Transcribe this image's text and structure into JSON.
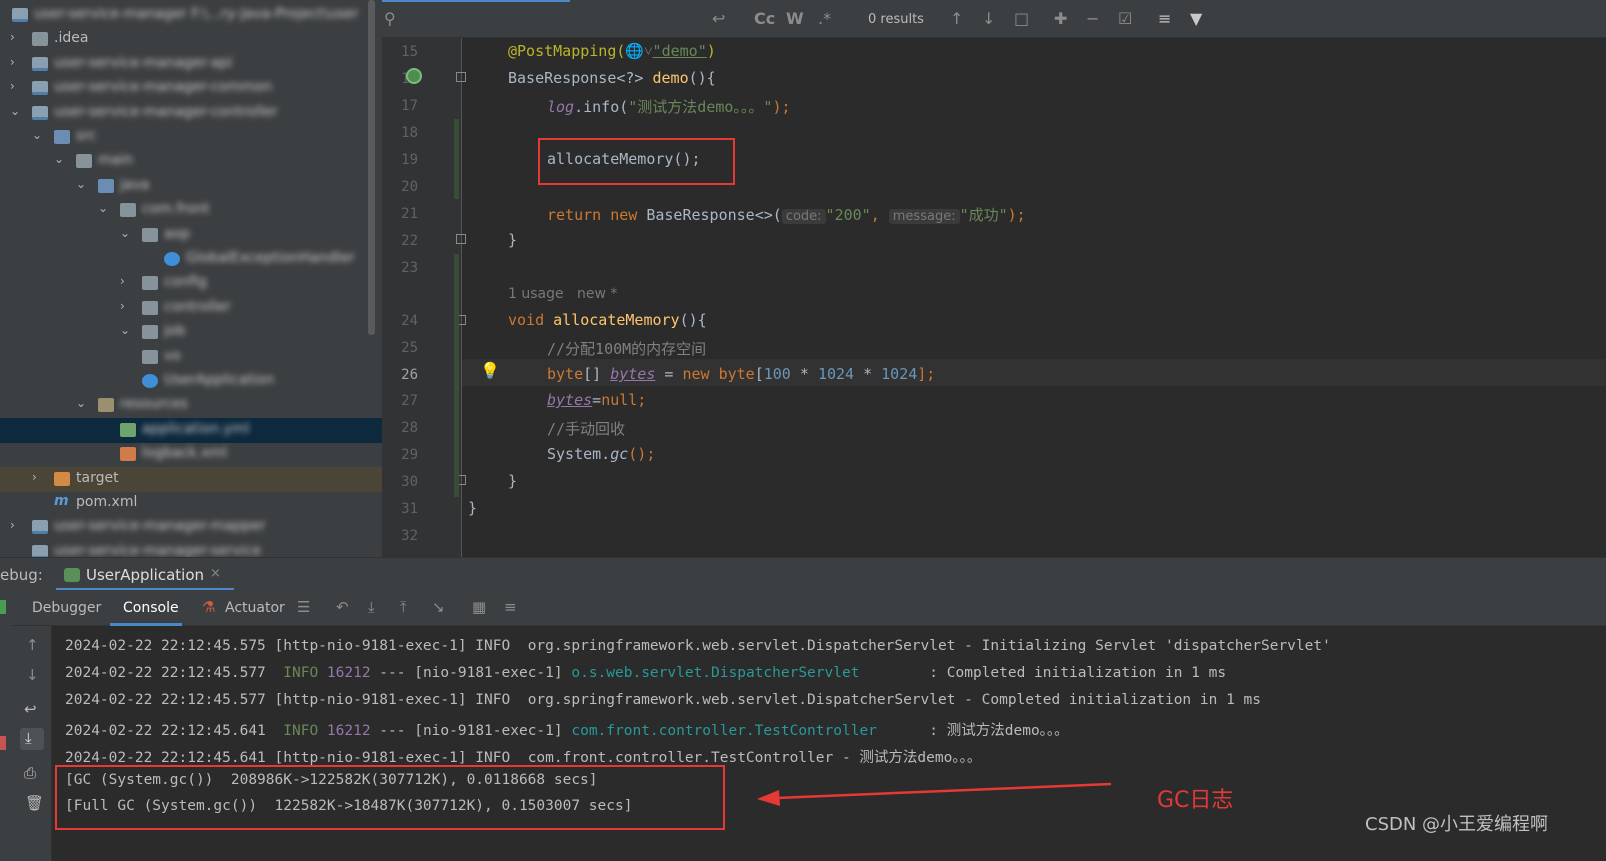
{
  "project_tree": {
    "rows": [
      {
        "label": "user-service-manager",
        "suffix": "F:\\...ry-Java-Project\\user",
        "blurred": true
      },
      {
        "label": ".idea",
        "blurred": false
      },
      {
        "label": "user-service-manager-api",
        "blurred": true
      },
      {
        "label": "user-service-manager-common",
        "blurred": true
      },
      {
        "label": "user-service-manager-controller",
        "blurred": true
      },
      {
        "label": "src",
        "blurred": true
      },
      {
        "label": "main",
        "blurred": true
      },
      {
        "label": "java",
        "blurred": true
      },
      {
        "label": "com.front",
        "blurred": true
      },
      {
        "label": "aop",
        "blurred": true
      },
      {
        "label": "GlobalExceptionHandler",
        "blurred": true
      },
      {
        "label": "config",
        "blurred": true
      },
      {
        "label": "controller",
        "blurred": true
      },
      {
        "label": "job",
        "blurred": true
      },
      {
        "label": "vo",
        "blurred": true
      },
      {
        "label": "UserApplication",
        "blurred": true
      },
      {
        "label": "resources",
        "blurred": true
      },
      {
        "label": "application.yml",
        "blurred": true
      },
      {
        "label": "logback.xml",
        "blurred": true
      },
      {
        "label": "target",
        "blurred": false
      },
      {
        "label": "pom.xml",
        "blurred": false
      },
      {
        "label": "user-service-manager-mapper",
        "blurred": true
      },
      {
        "label": "user-service-manager-service",
        "blurred": true
      }
    ]
  },
  "find_bar": {
    "results": "0 results",
    "case_label": "Cc",
    "word_label": "W",
    "regex_label": ".*"
  },
  "editor": {
    "line_numbers": [
      "15",
      "16",
      "17",
      "18",
      "19",
      "20",
      "21",
      "22",
      "23",
      "24",
      "25",
      "26",
      "27",
      "28",
      "29",
      "30",
      "31",
      "32"
    ],
    "current_line": "26",
    "code": {
      "l15_annot": "@PostMapping(",
      "l15_str": "\"demo\"",
      "l15_close": ")",
      "l16_type": "BaseResponse<?> ",
      "l16_fn": "demo",
      "l16_rest": "(){",
      "l17_log": "log",
      "l17_call": ".info(",
      "l17_str": "\"测试方法demo。。。\"",
      "l17_end": ");",
      "l19": "allocateMemory();",
      "l21_ret": "return new ",
      "l21_type": "BaseResponse<>(",
      "l21_hint_code": "code:",
      "l21_s1": "\"200\"",
      "l21_comma": ", ",
      "l21_hint_msg": "message:",
      "l21_s2": "\"成功\"",
      "l21_end": ");",
      "l22": "}",
      "lens_usage": "1 usage   new *",
      "l24_kw": "void ",
      "l24_fn": "allocateMemory",
      "l24_rest": "(){",
      "l25": "//分配100M的内存空间",
      "l26_kw": "byte",
      "l26_a": "[] ",
      "l26_var": "bytes",
      "l26_b": " = ",
      "l26_new": "new byte",
      "l26_c": "[",
      "l26_n1": "100",
      "l26_d": " * ",
      "l26_n2": "1024",
      "l26_e": " * ",
      "l26_n3": "1024",
      "l26_f": "];",
      "l27_var": "bytes",
      "l27_eq": "=",
      "l27_null": "null;",
      "l28": "//手动回收",
      "l29_a": "System.",
      "l29_gc": "gc",
      "l29_b": "();",
      "l30": "}",
      "l31": "}"
    }
  },
  "debug": {
    "label": "ebug:",
    "config": "UserApplication",
    "tabs": [
      "Debugger",
      "Console",
      "Actuator"
    ]
  },
  "console": {
    "lines": [
      {
        "ts": "2024-02-22 22:12:45.575",
        "text": " [http-nio-9181-exec-1] INFO  org.springframework.web.servlet.DispatcherServlet - Initializing Servlet 'dispatcherServlet'"
      },
      {
        "ts": "2024-02-22 22:12:45.577",
        "level": "  INFO ",
        "pid": "16212",
        "mid": " --- [nio-9181-exec-1] ",
        "cls": "o.s.web.servlet.DispatcherServlet       ",
        "msg": " : Completed initialization in 1 ms"
      },
      {
        "ts": "2024-02-22 22:12:45.577",
        "text": " [http-nio-9181-exec-1] INFO  org.springframework.web.servlet.DispatcherServlet - Completed initialization in 1 ms"
      },
      {
        "ts": "2024-02-22 22:12:45.641",
        "level": "  INFO ",
        "pid": "16212",
        "mid": " --- [nio-9181-exec-1] ",
        "cls": "com.front.controller.TestController     ",
        "msg": " : 测试方法demo。。。"
      },
      {
        "ts": "2024-02-22 22:12:45.641",
        "text": " [http-nio-9181-exec-1] INFO  com.front.controller.TestController - 测试方法demo。。。"
      }
    ],
    "gc_line_1": "[GC (System.gc())  208986K->122582K(307712K), 0.0118668 secs]",
    "gc_line_2": "[Full GC (System.gc())  122582K->18487K(307712K), 0.1503007 secs]"
  },
  "annotation": {
    "label": "GC日志",
    "color": "#e53935"
  },
  "watermark": "CSDN @小王爱编程啊"
}
